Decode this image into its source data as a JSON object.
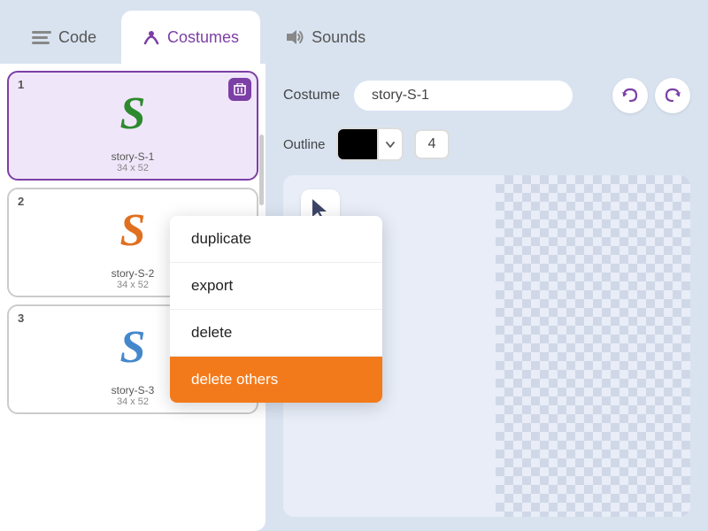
{
  "tabs": [
    {
      "id": "code",
      "label": "Code",
      "icon": "≡"
    },
    {
      "id": "costumes",
      "label": "Costumes",
      "icon": "✏"
    },
    {
      "id": "sounds",
      "label": "Sounds",
      "icon": "🔊"
    }
  ],
  "active_tab": "costumes",
  "costume_label": "Costume",
  "costume_name": "story-S-1",
  "outline_label": "Outline",
  "outline_value": "4",
  "costumes": [
    {
      "number": "1",
      "name": "story-S-1",
      "size": "34 x 52",
      "selected": true,
      "color": "green"
    },
    {
      "number": "2",
      "name": "story-S-2",
      "size": "34 x 52",
      "selected": false,
      "color": "orange"
    },
    {
      "number": "3",
      "name": "story-S-3",
      "size": "34 x 52",
      "selected": false,
      "color": "blue"
    }
  ],
  "context_menu": {
    "items": [
      {
        "id": "duplicate",
        "label": "duplicate",
        "active": false
      },
      {
        "id": "export",
        "label": "export",
        "active": false
      },
      {
        "id": "delete",
        "label": "delete",
        "active": false
      },
      {
        "id": "delete-others",
        "label": "delete others",
        "active": true
      }
    ]
  },
  "toolbar": {
    "undo_label": "↩",
    "redo_label": "↪"
  },
  "colors": {
    "accent": "#7c3fa6",
    "orange": "#f37a1b",
    "tab_active_bg": "#ffffff",
    "tab_inactive_bg": "#d9e3f0"
  }
}
